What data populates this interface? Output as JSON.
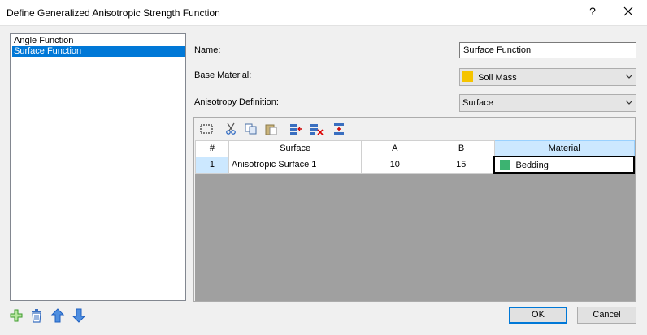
{
  "window": {
    "title": "Define Generalized Anisotropic Strength Function",
    "help_glyph": "?"
  },
  "functions_list": {
    "items": [
      "Angle Function",
      "Surface Function"
    ],
    "selected_index": 1
  },
  "form": {
    "name_label": "Name:",
    "name_value": "Surface Function",
    "base_material_label": "Base Material:",
    "base_material_value": "Soil Mass",
    "base_material_color": "#f5c400",
    "anisotropy_label": "Anisotropy Definition:",
    "anisotropy_value": "Surface"
  },
  "toolbar": {
    "icons": [
      "select-all-icon",
      "cut-icon",
      "copy-icon",
      "paste-icon",
      "insert-row-icon",
      "delete-row-icon",
      "append-row-icon"
    ]
  },
  "table": {
    "columns": [
      "#",
      "Surface",
      "A",
      "B",
      "Material"
    ],
    "rows": [
      {
        "num": "1",
        "surface": "Anisotropic Surface 1",
        "a": "10",
        "b": "15",
        "material": "Bedding",
        "material_color": "#3cb371"
      }
    ]
  },
  "bottom_icons": [
    "add-icon",
    "delete-icon",
    "move-up-icon",
    "move-down-icon"
  ],
  "buttons": {
    "ok": "OK",
    "cancel": "Cancel"
  },
  "colors": {
    "selection": "#0078d7",
    "grid_background": "#a0a0a0",
    "active_header": "#cce8ff"
  }
}
